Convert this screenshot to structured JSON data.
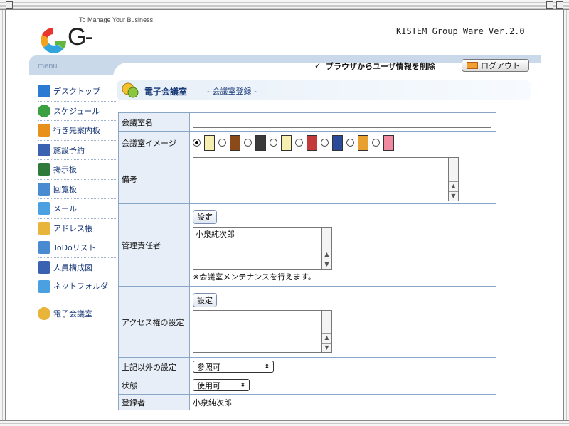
{
  "header": {
    "tagline": "To Manage Your Business",
    "logo_text": "G-BOARD",
    "version": "KISTEM Group Ware Ver.2.0"
  },
  "topbar": {
    "menu_label": "menu",
    "delete_browser_info": "ブラウザからユーザ情報を削除",
    "logout": "ログアウト"
  },
  "menu": {
    "items": [
      {
        "label": "デスクトップ",
        "icon": "up-arrow-icon",
        "color": "#2a7bd1"
      },
      {
        "label": "スケジュール",
        "icon": "clock-icon",
        "color": "#3aa040"
      },
      {
        "label": "行き先案内板",
        "icon": "right-arrow-icon",
        "color": "#e8901c"
      },
      {
        "label": "施設予約",
        "icon": "building-icon",
        "color": "#3b62b0"
      },
      {
        "label": "掲示板",
        "icon": "board-icon",
        "color": "#2f7a3a"
      },
      {
        "label": "回覧板",
        "icon": "check-board-icon",
        "color": "#4a8ad0"
      },
      {
        "label": "メール",
        "icon": "mail-icon",
        "color": "#4aa0e0"
      },
      {
        "label": "アドレス帳",
        "icon": "book-icon",
        "color": "#e8b43a"
      },
      {
        "label": "ToDoリスト",
        "icon": "checklist-icon",
        "color": "#4a8ad0"
      },
      {
        "label": "人員構成図",
        "icon": "org-chart-icon",
        "color": "#3b62b0"
      },
      {
        "label": "ネットフォルダ",
        "icon": "folder-icon",
        "color": "#4aa0e0"
      },
      {
        "label": "電子会議室",
        "icon": "meeting-icon",
        "color": "#e8b43a"
      }
    ]
  },
  "content": {
    "title": "電子会議室",
    "subtitle": "- 会議室登録 -",
    "form": {
      "room_name_label": "会議室名",
      "room_name_value": "",
      "image_label": "会議室イメージ",
      "doors": [
        "#f7efb0",
        "#8a4a1a",
        "#3a3a3a",
        "#f7efb0",
        "#c23a3a",
        "#2a4a9a",
        "#e8a030",
        "#f08aa0"
      ],
      "notes_label": "備考",
      "notes_value": "",
      "manager_label": "管理責任者",
      "manager_set_button": "設定",
      "manager_list": [
        "小泉純次郎"
      ],
      "manager_note": "※会議室メンテナンスを行えます。",
      "access_label": "アクセス権の設定",
      "access_set_button": "設定",
      "other_label": "上記以外の設定",
      "other_value": "参照可",
      "status_label": "状態",
      "status_value": "使用可",
      "registrant_label": "登録者",
      "registrant_value": "小泉純次郎"
    }
  }
}
